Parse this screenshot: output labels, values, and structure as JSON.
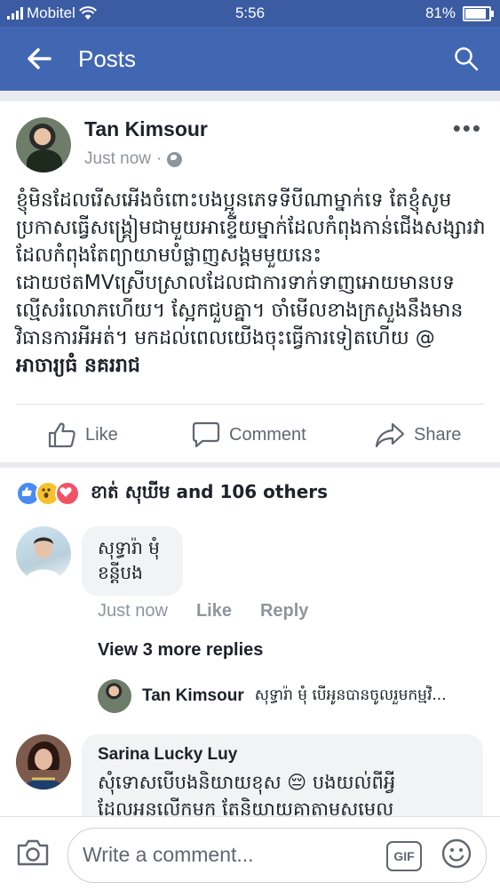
{
  "status_bar": {
    "carrier": "Mobitel",
    "time": "5:56",
    "battery": "81%",
    "battery_level": 0.81
  },
  "app_bar": {
    "title": "Posts"
  },
  "post": {
    "author": "Tan Kimsour",
    "timestamp": "Just now",
    "text": "ខ្ញុំមិនដែលរើសអើងចំពោះបងប្អូនភេទទីបីណាម្នាក់ទេ តែខ្ញុំសូមប្រកាសធ្វើសង្គ្រៀមជាមួយអាខ្ទើយម្នាក់ដែលកំពុងកាន់ជើងសង្សារវាដែលកំពុងតែព្យាយាមបំផ្លាញសង្គមមួយនេះដោយថតMVស្រើបស្រាលដែលជាការទាក់ទាញអោយមានបទល្មើសរំលោភហើយ។ ស្អែកជួបគ្នា។ ចាំមើលខាងក្រសួងនឹងមានវិធានការអីអត់។ មកដល់ពេលយើងចុះធ្វើការទៀតហើយ @ ",
    "mention": "អាចារ្យធំ នគររាជ"
  },
  "actions": {
    "like": "Like",
    "comment": "Comment",
    "share": "Share"
  },
  "reactions": {
    "summary": "ខាត់ សុឃីម and 106 others"
  },
  "comments": [
    {
      "text_line1": "សុទ្ធារ៉ា មុំ",
      "text_line2": "ខន្តីបង",
      "time": "Just now",
      "like": "Like",
      "reply": "Reply"
    },
    {
      "name": "Sarina Lucky Luy",
      "text_line1": "សុំទោសបើបងនិយាយខុស 😔 បងយល់ពីអ្វី",
      "text_line2": "ដែលអនលើកមក តែនិយាយគាតាមសមេល"
    }
  ],
  "replies": {
    "view_more": "View 3 more replies",
    "preview_name": "Tan Kimsour",
    "preview_text": "សុទ្ធារ៉ា មុំ បើអូនបានចូលរួមកម្មវិ..."
  },
  "composer": {
    "placeholder": "Write a comment...",
    "gif_label": "GIF"
  }
}
